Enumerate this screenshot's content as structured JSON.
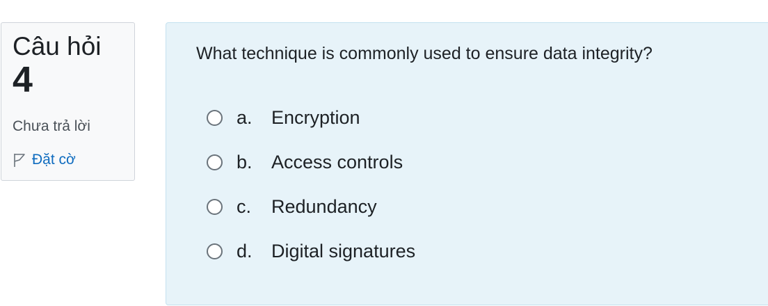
{
  "question_info": {
    "label": "Câu hỏi",
    "number": "4",
    "status": "Chưa trả lời",
    "flag_label": "Đặt cờ"
  },
  "question": {
    "text": "What technique is commonly used to ensure data integrity?",
    "options": [
      {
        "letter": "a.",
        "text": "Encryption",
        "selected": false
      },
      {
        "letter": "b.",
        "text": "Access controls",
        "selected": false
      },
      {
        "letter": "c.",
        "text": "Redundancy",
        "selected": false
      },
      {
        "letter": "d.",
        "text": "Digital signatures",
        "selected": false
      }
    ]
  },
  "colors": {
    "panel_background": "#e7f3f9",
    "info_background": "#f8f9fa",
    "link": "#0f6cbf",
    "text": "#1d2125"
  }
}
